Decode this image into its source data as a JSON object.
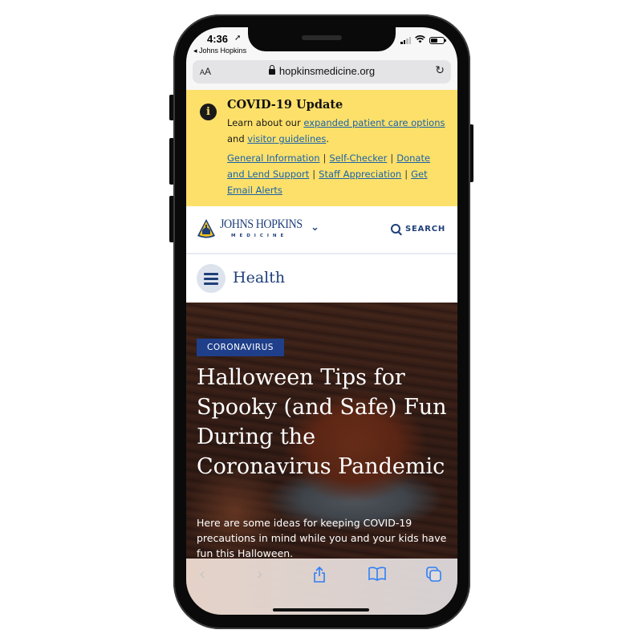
{
  "status_bar": {
    "time": "4:36",
    "back_app": "Johns Hopkins",
    "signal_bars_active": 2,
    "signal_bars_total": 4,
    "battery_level": 0.5
  },
  "browser": {
    "text_size_label": "AA",
    "url": "hopkinsmedicine.org",
    "lock_icon": "lock-icon",
    "reload_icon": "reload-icon"
  },
  "covid_banner": {
    "background": "#fde06a",
    "icon": "info-icon",
    "title": "COVID-19 Update",
    "text_before": "Learn about our ",
    "link_1": "expanded patient care options",
    "text_mid": " and ",
    "link_2": "visitor guidelines",
    "text_after": ".",
    "links": [
      "General Information",
      "Self-Checker",
      "Donate and Lend Support",
      "Staff Appreciation",
      "Get Email Alerts"
    ],
    "separator": "|"
  },
  "header": {
    "logo_name": "JOHNS HOPKINS",
    "logo_sub": "MEDICINE",
    "search_label": "SEARCH",
    "brand_color": "#1f3f7a"
  },
  "subnav": {
    "title": "Health"
  },
  "hero": {
    "tag": "CORONAVIRUS",
    "title": "Halloween Tips for Spooky (and Safe) Fun During the Coronavirus Pandemic",
    "description": "Here are some ideas for keeping COVID-19 precautions in mind while you and your kids have fun this Halloween."
  },
  "toolbar": {
    "back_icon": "‹",
    "forward_icon": "›",
    "accent": "#2f7ff6"
  }
}
